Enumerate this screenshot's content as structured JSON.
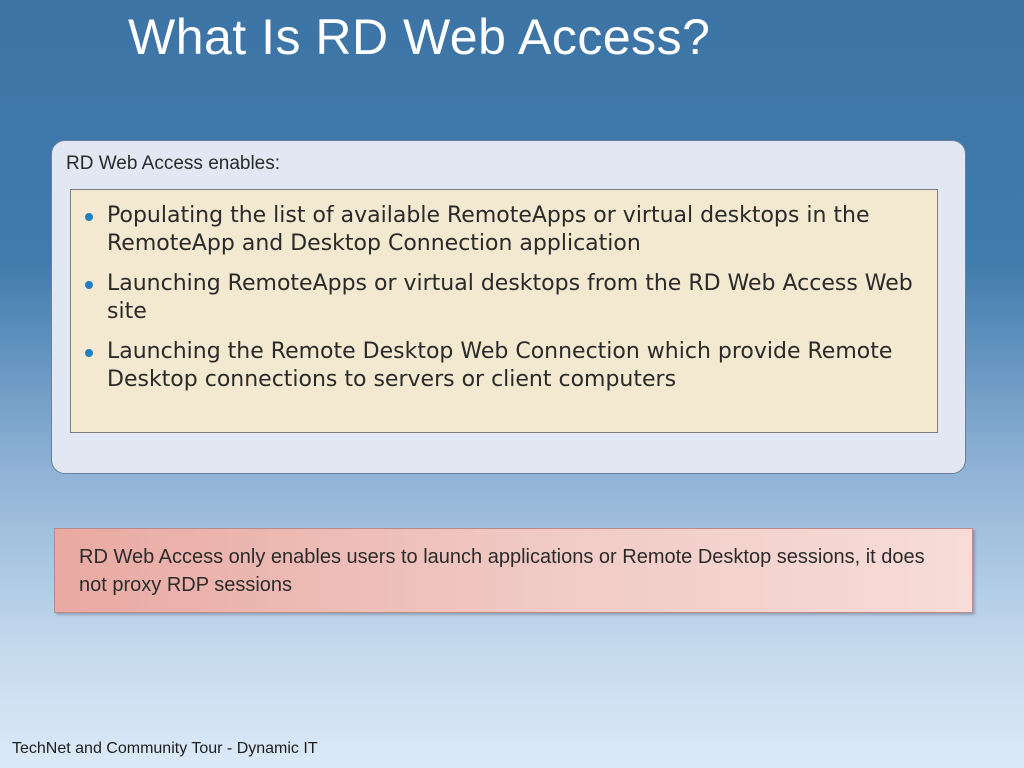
{
  "slide": {
    "title": "What Is RD Web Access?",
    "box_heading": "RD Web Access enables:",
    "bullets": [
      "Populating the list of available RemoteApps or virtual desktops in the RemoteApp and Desktop Connection application",
      "Launching RemoteApps or virtual desktops from the RD Web Access Web site",
      "Launching the Remote Desktop Web Connection which provide Remote Desktop connections to servers or client computers"
    ],
    "note": "RD Web Access only enables users to launch applications or Remote Desktop sessions, it does not proxy RDP sessions",
    "footer": "TechNet and Community Tour - Dynamic IT"
  },
  "colors": {
    "bullet": "#1f7fc1",
    "title": "#ffffff",
    "inner_box": "#f3e8d0",
    "outer_box": "#e1e8f3",
    "note_box": "#f1cbc6"
  }
}
